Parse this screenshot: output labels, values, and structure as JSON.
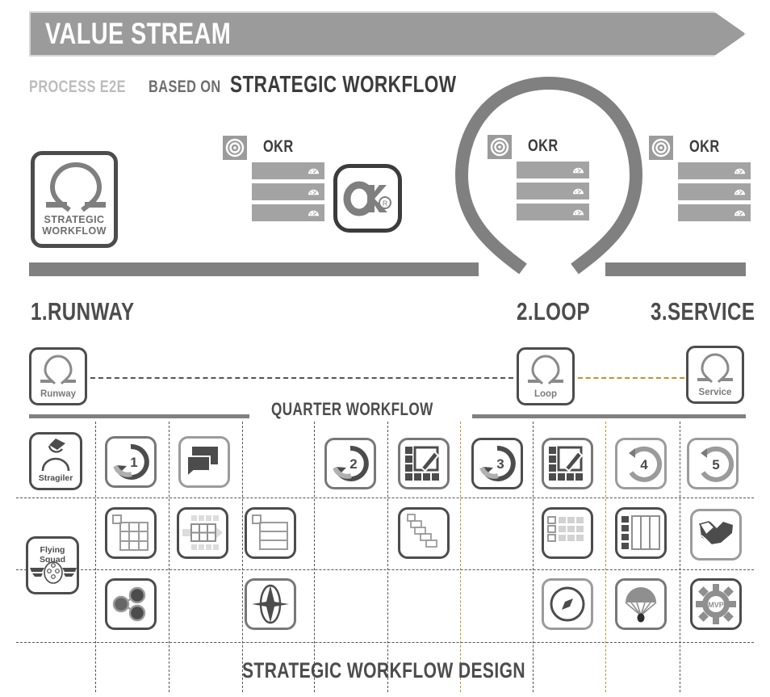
{
  "banner": {
    "title": "VALUE STREAM"
  },
  "subtitle": {
    "part1": "PROCESS E2E",
    "part2": "BASED ON",
    "part3": "STRATEGIC WORKFLOW"
  },
  "strategic_workflow_card": {
    "label_line1": "STRATEGIC",
    "label_line2": "WORKFLOW",
    "icon": "loop-bar-icon"
  },
  "ok_logo": {
    "text": "OK",
    "registered": "®",
    "icon": "ok-logo-icon"
  },
  "okr_blocks": [
    {
      "title": "OKR",
      "target_icon": "target-icon",
      "rows": [
        "",
        "",
        ""
      ],
      "row_icon": "gauge-icon"
    },
    {
      "title": "OKR",
      "target_icon": "target-icon",
      "rows": [
        "",
        "",
        ""
      ],
      "row_icon": "gauge-icon"
    },
    {
      "title": "OKR",
      "target_icon": "target-icon",
      "rows": [
        "",
        "",
        ""
      ],
      "row_icon": "gauge-icon"
    }
  ],
  "stages": [
    {
      "label": "1.RUNWAY",
      "card_label": "Runway",
      "icon": "loop-bar-icon"
    },
    {
      "label": "2.LOOP",
      "card_label": "Loop",
      "icon": "loop-bar-icon"
    },
    {
      "label": "3.SERVICE",
      "card_label": "Service",
      "icon": "loop-bar-icon"
    }
  ],
  "quarter_workflow": {
    "label": "QUARTER WORKFLOW"
  },
  "bottom_caption": {
    "label": "STRATEGIC WORKFLOW DESIGN"
  },
  "role_tiles": [
    {
      "label": "Stragiler",
      "icon": "person-cap-icon"
    },
    {
      "label": "Flying Squad",
      "icon": "winged-badge-icon"
    }
  ],
  "step_tiles": [
    {
      "number": "1",
      "icon": "refresh-arrow-icon"
    },
    {
      "number": "2",
      "icon": "refresh-arrow-icon"
    },
    {
      "number": "3",
      "icon": "refresh-arrow-icon"
    },
    {
      "number": "4",
      "icon": "refresh-arrow-icon"
    },
    {
      "number": "5",
      "icon": "refresh-arrow-icon"
    }
  ],
  "artifact_tiles": [
    {
      "icon": "chat-bubbles-icon"
    },
    {
      "icon": "edit-board-icon"
    },
    {
      "icon": "edit-board-icon"
    },
    {
      "icon": "grid-table-icon"
    },
    {
      "icon": "grid-flow-icon"
    },
    {
      "icon": "list-rows-icon"
    },
    {
      "icon": "stairs-icon"
    },
    {
      "icon": "list-grid-icon"
    },
    {
      "icon": "kanban-icon"
    },
    {
      "icon": "handshake-icon"
    },
    {
      "icon": "dependency-icon"
    },
    {
      "icon": "compass-star-icon"
    },
    {
      "icon": "compass-icon"
    },
    {
      "icon": "parachute-icon"
    },
    {
      "icon": "mvp-gear-icon",
      "label": "MVP"
    }
  ],
  "colors": {
    "banner_fill": "#9b9b9b",
    "bar_gray": "#808080",
    "dark_gray": "#4c4c4c",
    "mid_gray": "#777777",
    "light_gray": "#9b9b9b",
    "accent_amber": "#c8902a",
    "text_dark": "#3c3c3c",
    "white": "#ffffff"
  }
}
